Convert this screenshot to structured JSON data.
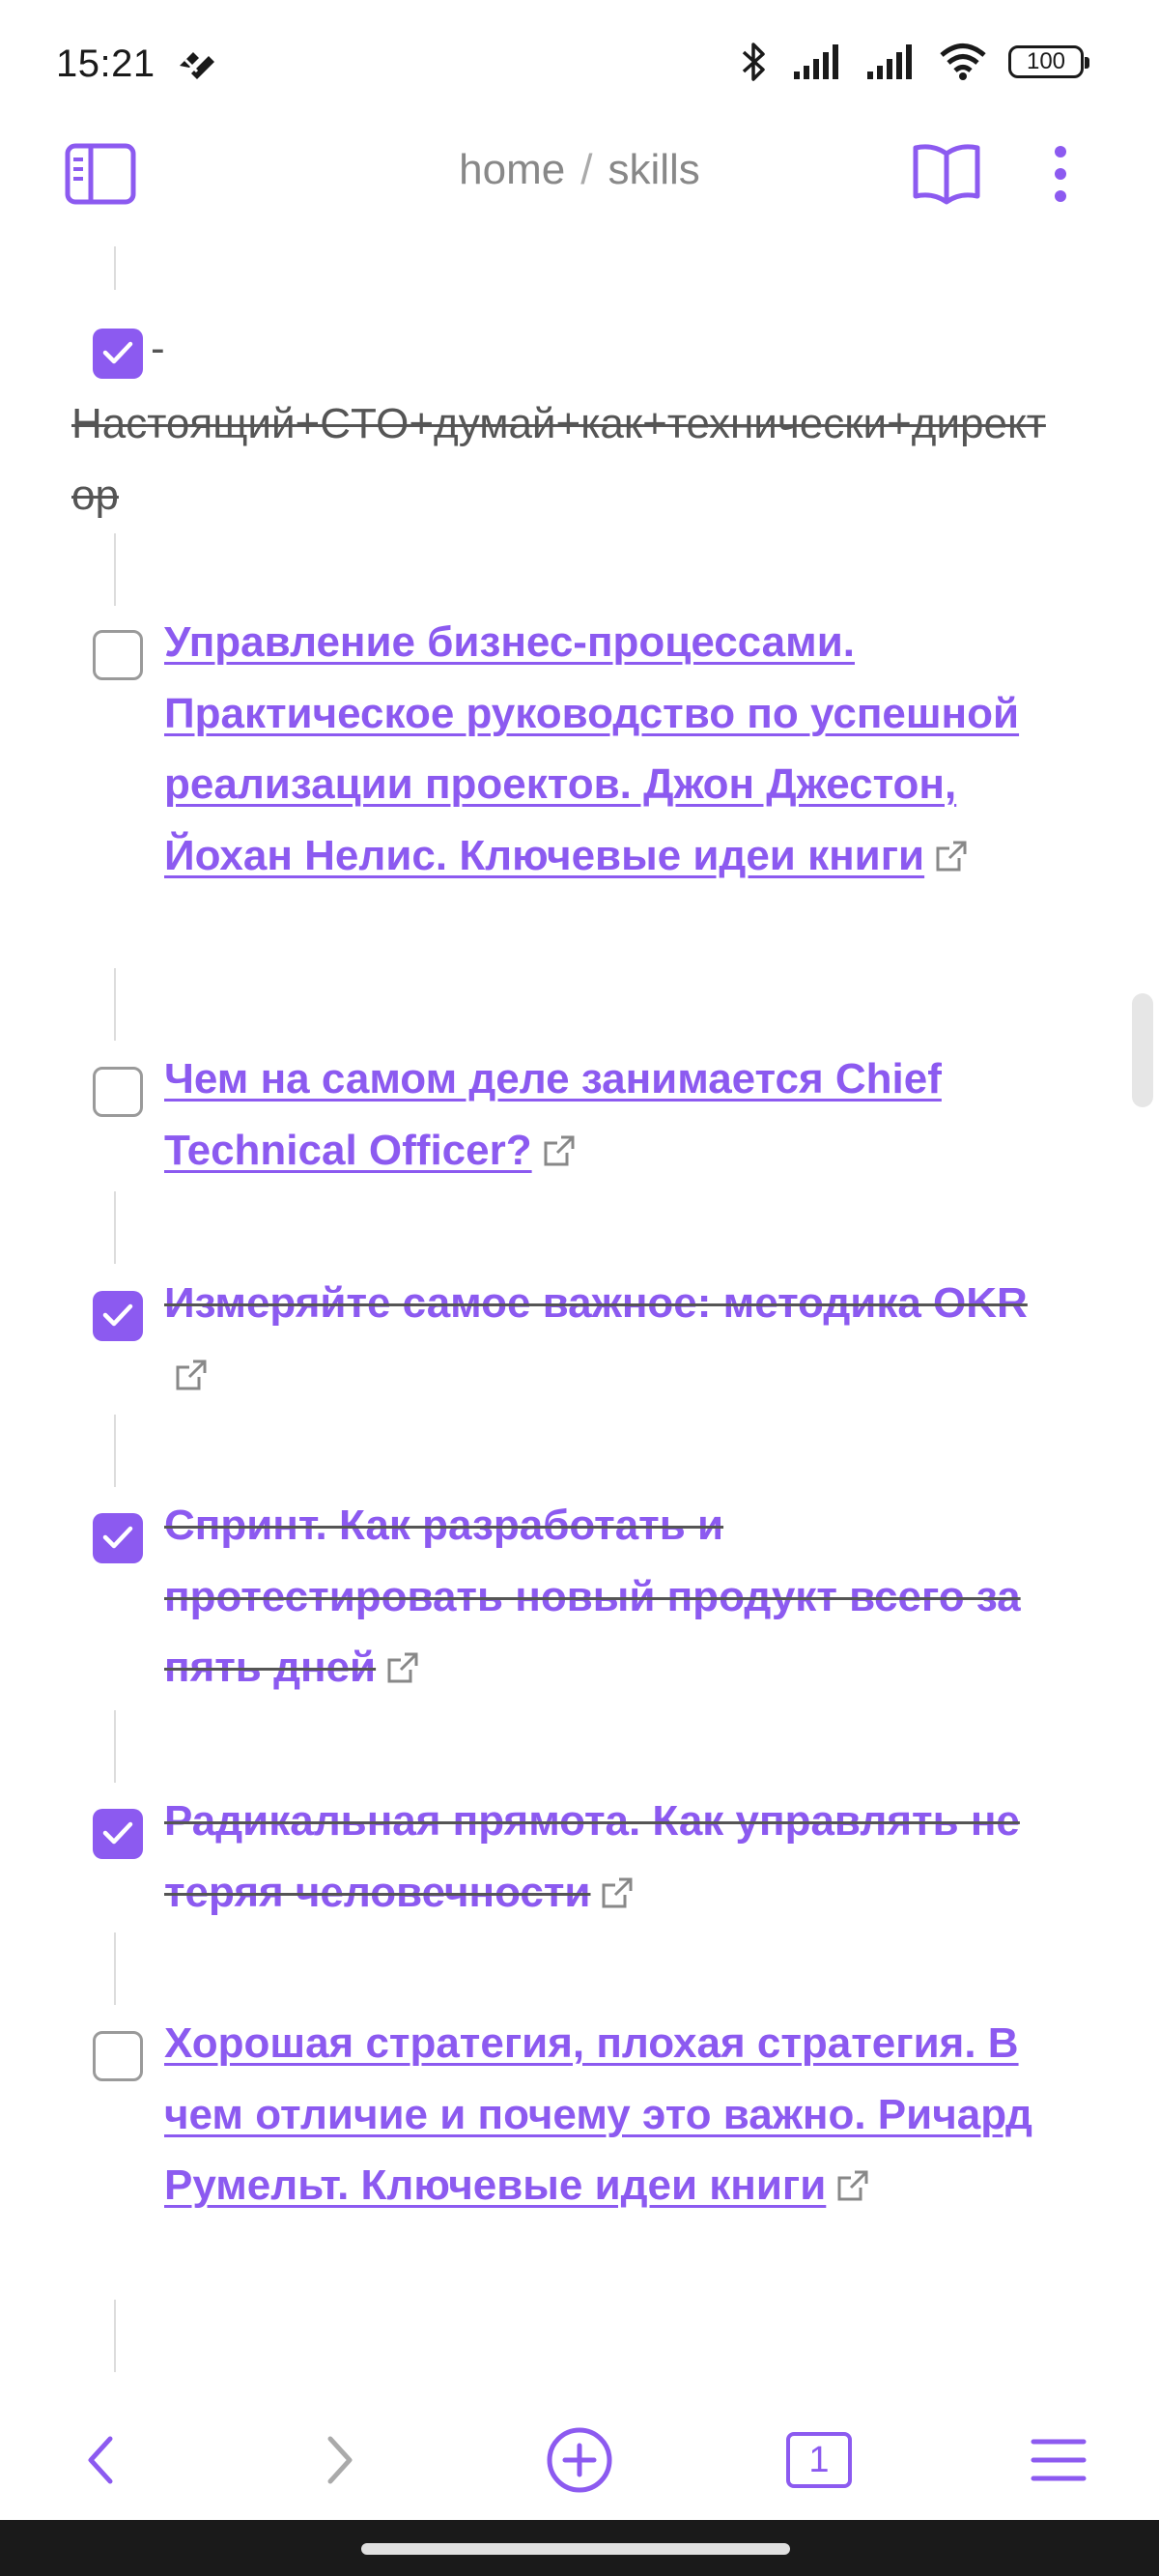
{
  "status_bar": {
    "time": "15:21",
    "battery": "100",
    "icons": [
      "app-notification-icon",
      "bluetooth-icon",
      "signal-icon",
      "signal-icon",
      "wifi-icon",
      "battery-icon"
    ]
  },
  "top_bar": {
    "breadcrumb": [
      "home",
      "skills"
    ],
    "separator": "/",
    "icons": [
      "sidebar-toggle-icon",
      "book-open-icon",
      "more-vertical-icon"
    ]
  },
  "tasks": [
    {
      "checked": true,
      "prefix": "-",
      "text": "Настоящий+CTO+думай+как+технически+директор",
      "is_link": false
    },
    {
      "checked": false,
      "text": "Управление бизнес-процессами. Практическое руководство по успешной реализации проектов. Джон Джестон, Йохан Нелис. Ключевые идеи книги",
      "is_link": true
    },
    {
      "checked": false,
      "text": "Чем на самом деле занимается Chief Technical Officer?",
      "is_link": true
    },
    {
      "checked": true,
      "text": "Измеряйте самое важное: методика OKR",
      "is_link": true
    },
    {
      "checked": true,
      "text": "Спринт. Как разработать и протестировать новый продукт всего за пять дней",
      "is_link": true
    },
    {
      "checked": true,
      "text": "Радикальная прямота. Как управлять не теряя человечности",
      "is_link": true
    },
    {
      "checked": false,
      "text": "Хорошая стратегия, плохая стратегия. В чем отличие и почему это важно. Ричард Румельт. Ключевые идеи книги",
      "is_link": true
    }
  ],
  "bottom_bar": {
    "tab_count": "1",
    "icons": [
      "back-arrow-icon",
      "forward-arrow-icon",
      "add-circle-icon",
      "tabs-icon",
      "hamburger-menu-icon"
    ]
  },
  "colors": {
    "accent": "#8c5af0",
    "done_text": "#555555",
    "breadcrumb": "#888888"
  }
}
